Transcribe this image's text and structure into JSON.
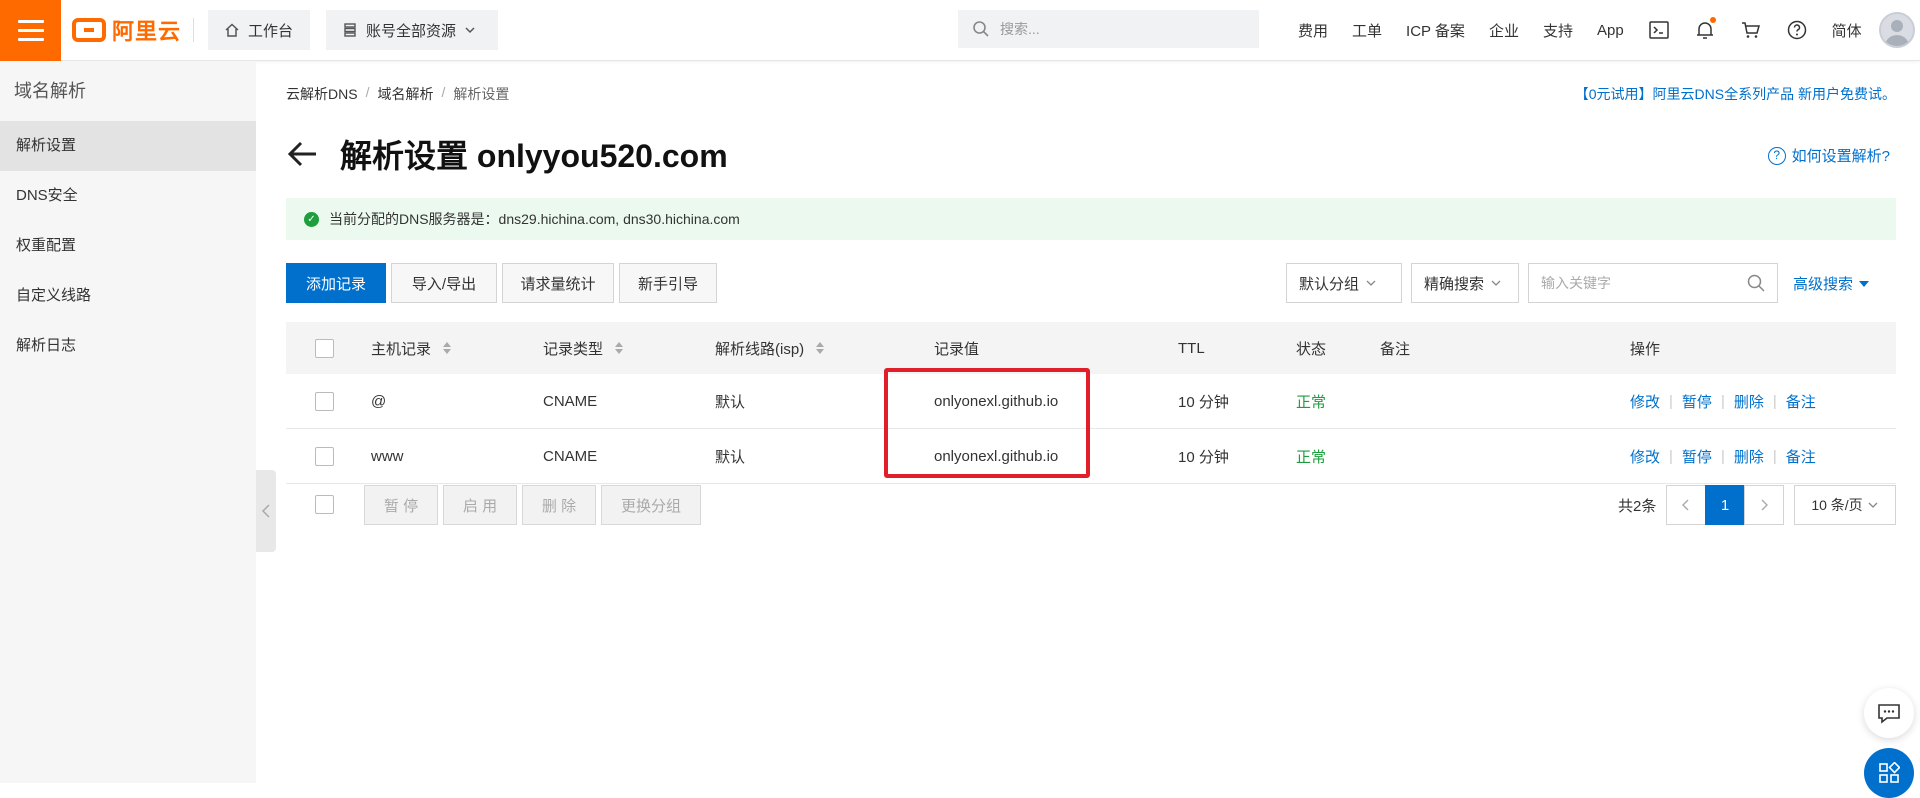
{
  "header": {
    "logo_text": "阿里云",
    "workbench": "工作台",
    "resources": "账号全部资源",
    "search_placeholder": "搜索...",
    "nav": [
      "费用",
      "工单",
      "ICP 备案",
      "企业",
      "支持",
      "App"
    ],
    "lang": "简体",
    "notification_dot_color": "#ff6a00",
    "accent_color": "#ff6a00"
  },
  "sidebar": {
    "title": "域名解析",
    "items": [
      {
        "label": "解析设置",
        "active": true
      },
      {
        "label": "DNS安全",
        "active": false
      },
      {
        "label": "权重配置",
        "active": false
      },
      {
        "label": "自定义线路",
        "active": false
      },
      {
        "label": "解析日志",
        "active": false
      }
    ]
  },
  "breadcrumb": [
    "云解析DNS",
    "域名解析",
    "解析设置"
  ],
  "promo": "【0元试用】阿里云DNS全系列产品 新用户免费试。",
  "title": "解析设置 onlyyou520.com",
  "help": "如何设置解析?",
  "notice": "当前分配的DNS服务器是：dns29.hichina.com, dns30.hichina.com",
  "toolbar": {
    "add": "添加记录",
    "import": "导入/导出",
    "stats": "请求量统计",
    "guide": "新手引导",
    "group": "默认分组",
    "precise": "精确搜索",
    "keyword_placeholder": "输入关键字",
    "advanced": "高级搜索"
  },
  "table": {
    "headers": {
      "host": "主机记录",
      "type": "记录类型",
      "line": "解析线路(isp)",
      "value": "记录值",
      "ttl": "TTL",
      "status": "状态",
      "remark": "备注",
      "ops": "操作"
    },
    "rows": [
      {
        "host": "@",
        "type": "CNAME",
        "line": "默认",
        "value": "onlyonexl.github.io",
        "ttl": "10 分钟",
        "status": "正常",
        "remark": ""
      },
      {
        "host": "www",
        "type": "CNAME",
        "line": "默认",
        "value": "onlyonexl.github.io",
        "ttl": "10 分钟",
        "status": "正常",
        "remark": ""
      }
    ],
    "ops": [
      "修改",
      "暂停",
      "删除",
      "备注"
    ]
  },
  "bulk": {
    "pause": "暂 停",
    "enable": "启 用",
    "delete": "删 除",
    "change_group": "更换分组"
  },
  "pagination": {
    "total": "共2条",
    "current": "1",
    "page_size": "10 条/页"
  },
  "colors": {
    "primary": "#0070cc",
    "success": "#1e9e3e",
    "highlight": "#e01f2a"
  }
}
